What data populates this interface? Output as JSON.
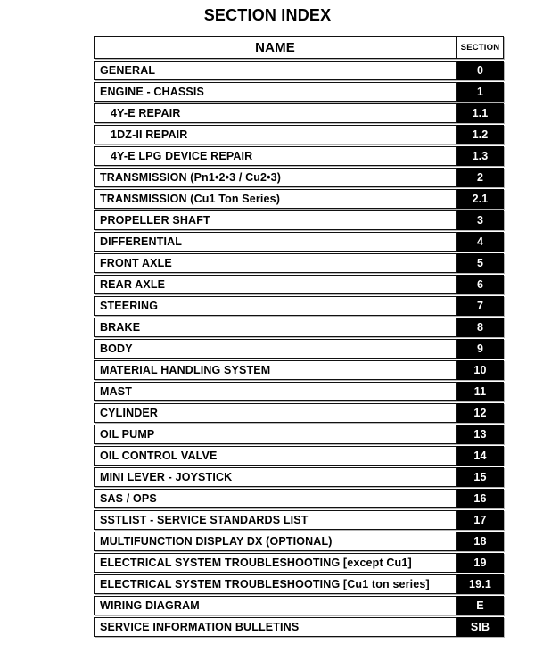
{
  "document": {
    "title": "SECTION INDEX"
  },
  "table": {
    "headers": {
      "name": "NAME",
      "section": "SECTION"
    },
    "rows": [
      {
        "name": "GENERAL",
        "section": "0",
        "indent": false
      },
      {
        "name": "ENGINE - CHASSIS",
        "section": "1",
        "indent": false
      },
      {
        "name": "4Y-E REPAIR",
        "section": "1.1",
        "indent": true
      },
      {
        "name": "1DZ-II REPAIR",
        "section": "1.2",
        "indent": true
      },
      {
        "name": "4Y-E LPG DEVICE REPAIR",
        "section": "1.3",
        "indent": true
      },
      {
        "name": "TRANSMISSION (Pn1•2•3 / Cu2•3)",
        "section": "2",
        "indent": false
      },
      {
        "name": "TRANSMISSION (Cu1 Ton Series)",
        "section": "2.1",
        "indent": false
      },
      {
        "name": "PROPELLER SHAFT",
        "section": "3",
        "indent": false
      },
      {
        "name": "DIFFERENTIAL",
        "section": "4",
        "indent": false
      },
      {
        "name": "FRONT AXLE",
        "section": "5",
        "indent": false
      },
      {
        "name": "REAR AXLE",
        "section": "6",
        "indent": false
      },
      {
        "name": "STEERING",
        "section": "7",
        "indent": false
      },
      {
        "name": "BRAKE",
        "section": "8",
        "indent": false
      },
      {
        "name": "BODY",
        "section": "9",
        "indent": false
      },
      {
        "name": "MATERIAL HANDLING SYSTEM",
        "section": "10",
        "indent": false
      },
      {
        "name": "MAST",
        "section": "11",
        "indent": false
      },
      {
        "name": "CYLINDER",
        "section": "12",
        "indent": false
      },
      {
        "name": "OIL PUMP",
        "section": "13",
        "indent": false
      },
      {
        "name": "OIL CONTROL VALVE",
        "section": "14",
        "indent": false
      },
      {
        "name": "MINI LEVER - JOYSTICK",
        "section": "15",
        "indent": false
      },
      {
        "name": "SAS / OPS",
        "section": "16",
        "indent": false
      },
      {
        "name": "SSTLIST - SERVICE STANDARDS LIST",
        "section": "17",
        "indent": false
      },
      {
        "name": "MULTIFUNCTION DISPLAY DX (OPTIONAL)",
        "section": "18",
        "indent": false
      },
      {
        "name": "ELECTRICAL SYSTEM TROUBLESHOOTING [except Cu1]",
        "section": "19",
        "indent": false
      },
      {
        "name": "ELECTRICAL SYSTEM TROUBLESHOOTING [Cu1 ton series]",
        "section": "19.1",
        "indent": false
      },
      {
        "name": "WIRING DIAGRAM",
        "section": "E",
        "indent": false
      },
      {
        "name": "SERVICE INFORMATION BULLETINS",
        "section": "SIB",
        "indent": false
      }
    ]
  },
  "colors": {
    "section_tab_background": "#000000",
    "section_tab_text": "#ffffff",
    "page_background": "#ffffff",
    "cell_border": "#111111",
    "cell_shadow": "#b5b5b5"
  }
}
